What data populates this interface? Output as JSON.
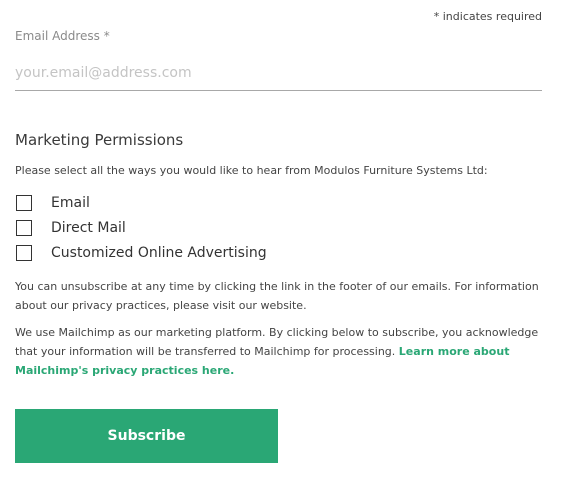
{
  "form": {
    "required_note": "* indicates required",
    "email": {
      "label": "Email Address *",
      "placeholder": "your.email@address.com",
      "value": ""
    }
  },
  "marketing": {
    "heading": "Marketing Permissions",
    "description": "Please select all the ways you would like to hear from Modulos Furniture Systems Ltd:",
    "options": [
      {
        "label": "Email",
        "checked": false
      },
      {
        "label": "Direct Mail",
        "checked": false
      },
      {
        "label": "Customized Online Advertising",
        "checked": false
      }
    ],
    "unsubscribe_text": "You can unsubscribe at any time by clicking the link in the footer of our emails. For information about our privacy practices, please visit our website.",
    "platform_text": "We use Mailchimp as our marketing platform. By clicking below to subscribe, you acknowledge that your information will be transferred to Mailchimp for processing.",
    "platform_link": "Learn more about Mailchimp's privacy practices here."
  },
  "actions": {
    "subscribe_label": "Subscribe"
  },
  "colors": {
    "accent": "#2aa775",
    "text": "#333333",
    "muted": "#8a8a8a"
  }
}
